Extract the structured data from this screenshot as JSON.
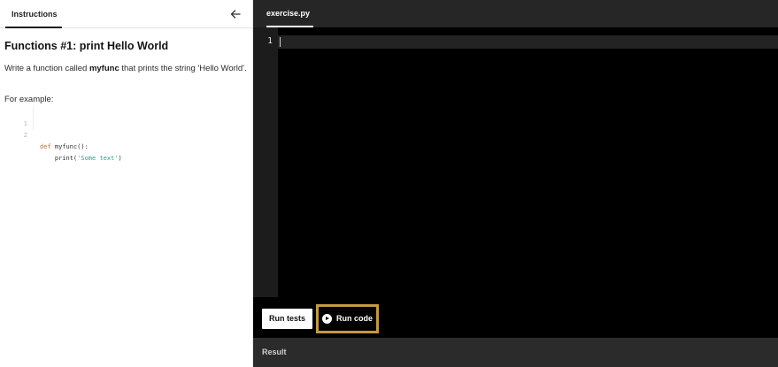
{
  "left_panel": {
    "tab_label": "Instructions",
    "title": "Functions #1: print Hello World",
    "description_pre": "Write a function called ",
    "description_bold": "myfunc",
    "description_post": " that prints the string 'Hello World'.",
    "example_label": "For example:",
    "code_lines": [
      {
        "num": "1",
        "keyword": "def",
        "rest": " myfunc():"
      },
      {
        "num": "2",
        "indent": "    print(",
        "string": "'Some text'",
        "tail": ")"
      }
    ]
  },
  "editor": {
    "file_tab": "exercise.py",
    "line_number": "1",
    "run_tests_label": "Run tests",
    "run_code_label": "Run code",
    "result_label": "Result"
  },
  "colors": {
    "highlight_border": "#c39a45",
    "keyword": "#b7743b",
    "string": "#2e9e8f"
  }
}
